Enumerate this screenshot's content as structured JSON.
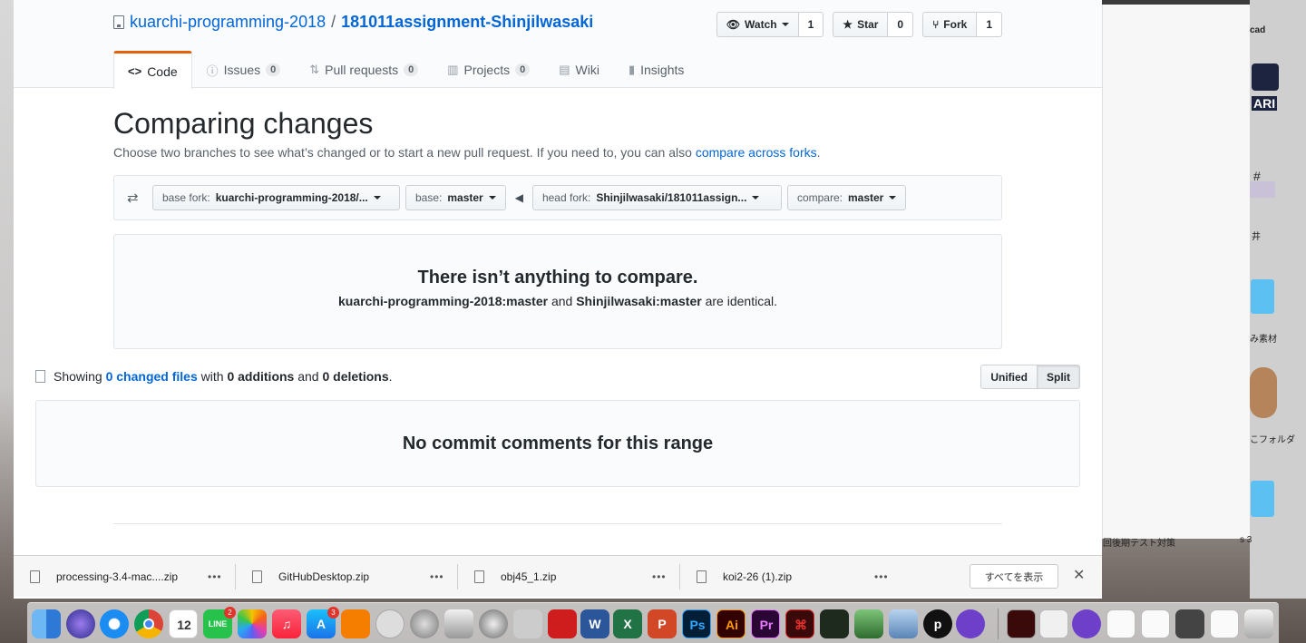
{
  "repo": {
    "owner": "kuarchi-programming-2018",
    "separator": "/",
    "name": "181011assignment-Shinjilwasaki"
  },
  "actions": [
    {
      "label": "Watch",
      "count": "1",
      "icon": "eye-icon"
    },
    {
      "label": "Star",
      "count": "0",
      "icon": "star-icon"
    },
    {
      "label": "Fork",
      "count": "1",
      "icon": "fork-icon"
    }
  ],
  "nav": {
    "code": {
      "label": "Code"
    },
    "issues": {
      "label": "Issues",
      "count": "0"
    },
    "pulls": {
      "label": "Pull requests",
      "count": "0"
    },
    "projects": {
      "label": "Projects",
      "count": "0"
    },
    "wiki": {
      "label": "Wiki"
    },
    "insights": {
      "label": "Insights"
    }
  },
  "compare": {
    "title": "Comparing changes",
    "lead": "Choose two branches to see what’s changed or to start a new pull request. If you need to, you can also ",
    "lead_link": "compare across forks",
    "lead_end": ".",
    "base_fork_label": "base fork:",
    "base_fork_value": "kuarchi-programming-2018/...",
    "base_label": "base:",
    "base_value": "master",
    "head_fork_label": "head fork:",
    "head_fork_value": "Shinjilwasaki/181011assign...",
    "compare_label": "compare:",
    "compare_value": "master"
  },
  "blankslate": {
    "title": "There isn’t anything to compare.",
    "base_ref": "kuarchi-programming-2018:master",
    "and": " and ",
    "head_ref": "Shinjilwasaki:master",
    "suffix": " are identical."
  },
  "toc": {
    "showing": "Showing ",
    "changed_files": "0 changed files",
    "with": " with ",
    "additions": "0 additions",
    "and": " and ",
    "deletions": "0 deletions",
    "end": ".",
    "unified": "Unified",
    "split": "Split"
  },
  "no_comments": "No commit comments for this range",
  "downloads": [
    {
      "name": "processing-3.4-mac....zip"
    },
    {
      "name": "GitHubDesktop.zip"
    },
    {
      "name": "obj45_1.zip"
    },
    {
      "name": "koi2-26 (1).zip"
    }
  ],
  "show_all": "すべてを表示",
  "desktop_labels": {
    "cad": "cad",
    "folder1": "み素材",
    "folder2": "こフォルダ",
    "test": "回後期テスト対策",
    "s3": "s 3",
    "ari": "ARI",
    "num": "#",
    "i": "井"
  },
  "dock_calendar": "12",
  "dock_badges": {
    "line": "2",
    "appstore": "3"
  },
  "colors": {
    "link": "#0366d6",
    "accent": "#e36209",
    "text": "#24292e",
    "muted": "#586069"
  }
}
